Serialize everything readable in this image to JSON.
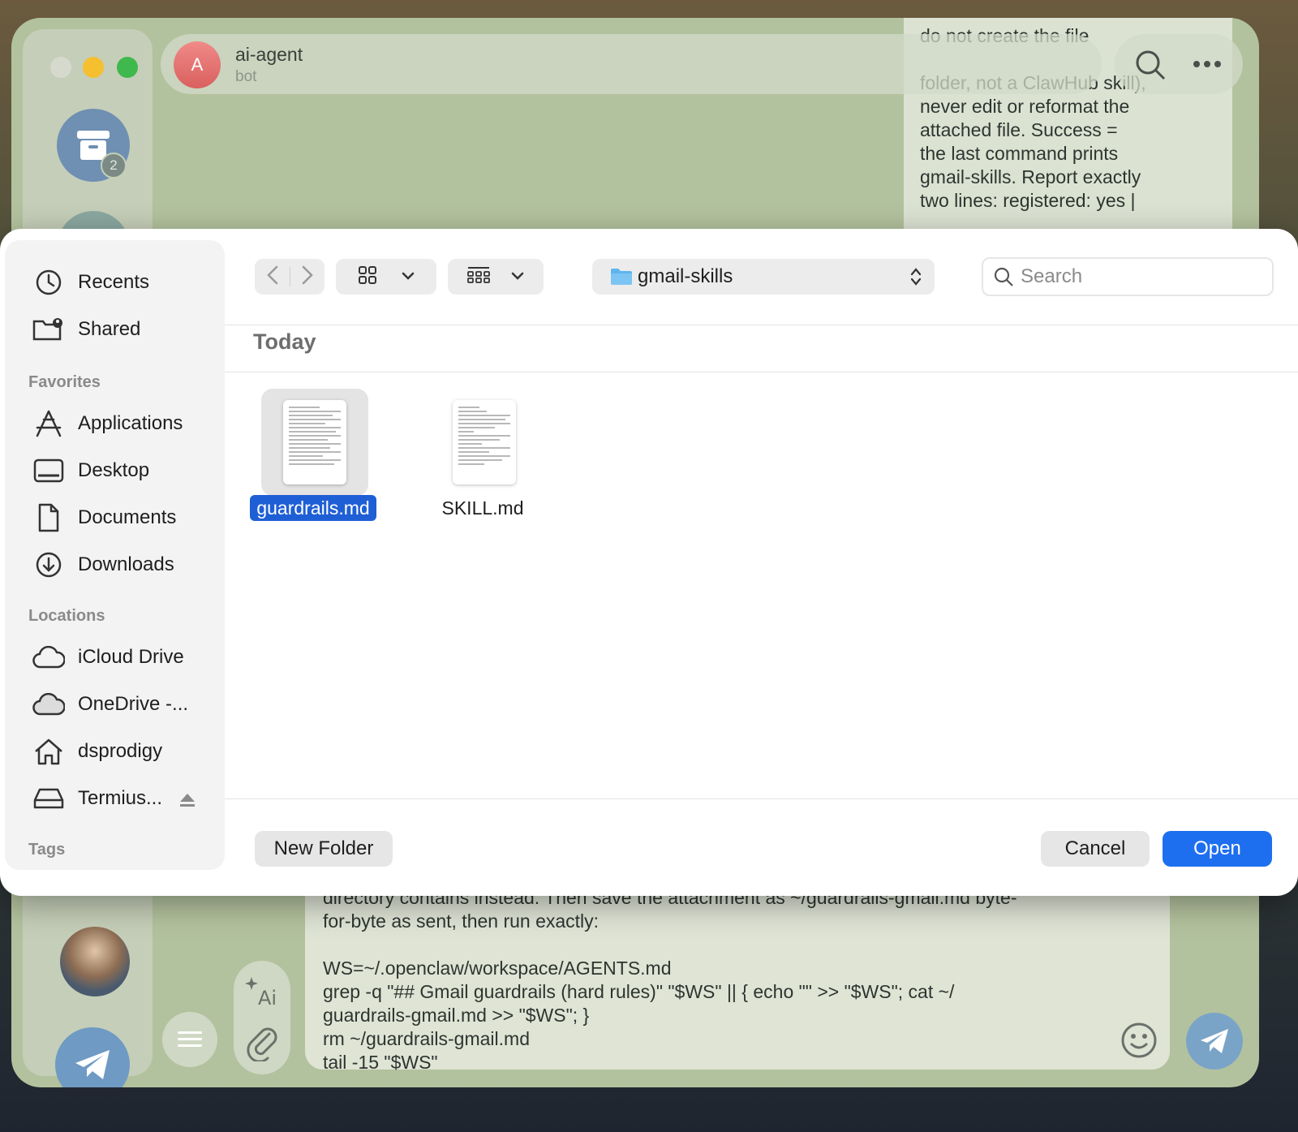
{
  "telegram": {
    "archive_badge": "2",
    "chat": {
      "avatar_letter": "A",
      "title": "ai-agent",
      "subtitle": "bot"
    },
    "top_message": "do not create the file\n\nfolder, not a ClawHub skill),\nnever edit or reformat the\nattached file. Success =\nthe last command prints\ngmail-skills. Report exactly\ntwo lines: registered: yes |",
    "bottom_message": "directory contains instead. Then save the attachment as ~/guardrails-gmail.md byte-\nfor-byte as sent, then run exactly:\n\nWS=~/.openclaw/workspace/AGENTS.md\ngrep -q \"## Gmail guardrails (hard rules)\" \"$WS\" || { echo \"\" >> \"$WS\"; cat ~/\nguardrails-gmail.md >> \"$WS\"; }\nrm ~/guardrails-gmail.md\ntail -15 \"$WS\""
  },
  "dialog": {
    "sidebar": {
      "top_items": [
        {
          "label": "Recents",
          "icon": "clock-icon"
        },
        {
          "label": "Shared",
          "icon": "shared-folder-icon"
        }
      ],
      "favorites_title": "Favorites",
      "favorites": [
        {
          "label": "Applications",
          "icon": "applications-icon"
        },
        {
          "label": "Desktop",
          "icon": "desktop-icon"
        },
        {
          "label": "Documents",
          "icon": "document-icon"
        },
        {
          "label": "Downloads",
          "icon": "download-icon"
        }
      ],
      "locations_title": "Locations",
      "locations": [
        {
          "label": "iCloud Drive",
          "icon": "cloud-icon"
        },
        {
          "label": "OneDrive -...",
          "icon": "onedrive-icon"
        },
        {
          "label": "dsprodigy",
          "icon": "home-icon"
        },
        {
          "label": "Termius...",
          "icon": "drive-icon"
        }
      ],
      "tags_title": "Tags"
    },
    "toolbar": {
      "current_folder": "gmail-skills",
      "search_placeholder": "Search"
    },
    "group_title": "Today",
    "files": [
      {
        "name": "guardrails.md",
        "selected": true
      },
      {
        "name": "SKILL.md",
        "selected": false
      }
    ],
    "buttons": {
      "new_folder": "New Folder",
      "cancel": "Cancel",
      "open": "Open"
    }
  }
}
